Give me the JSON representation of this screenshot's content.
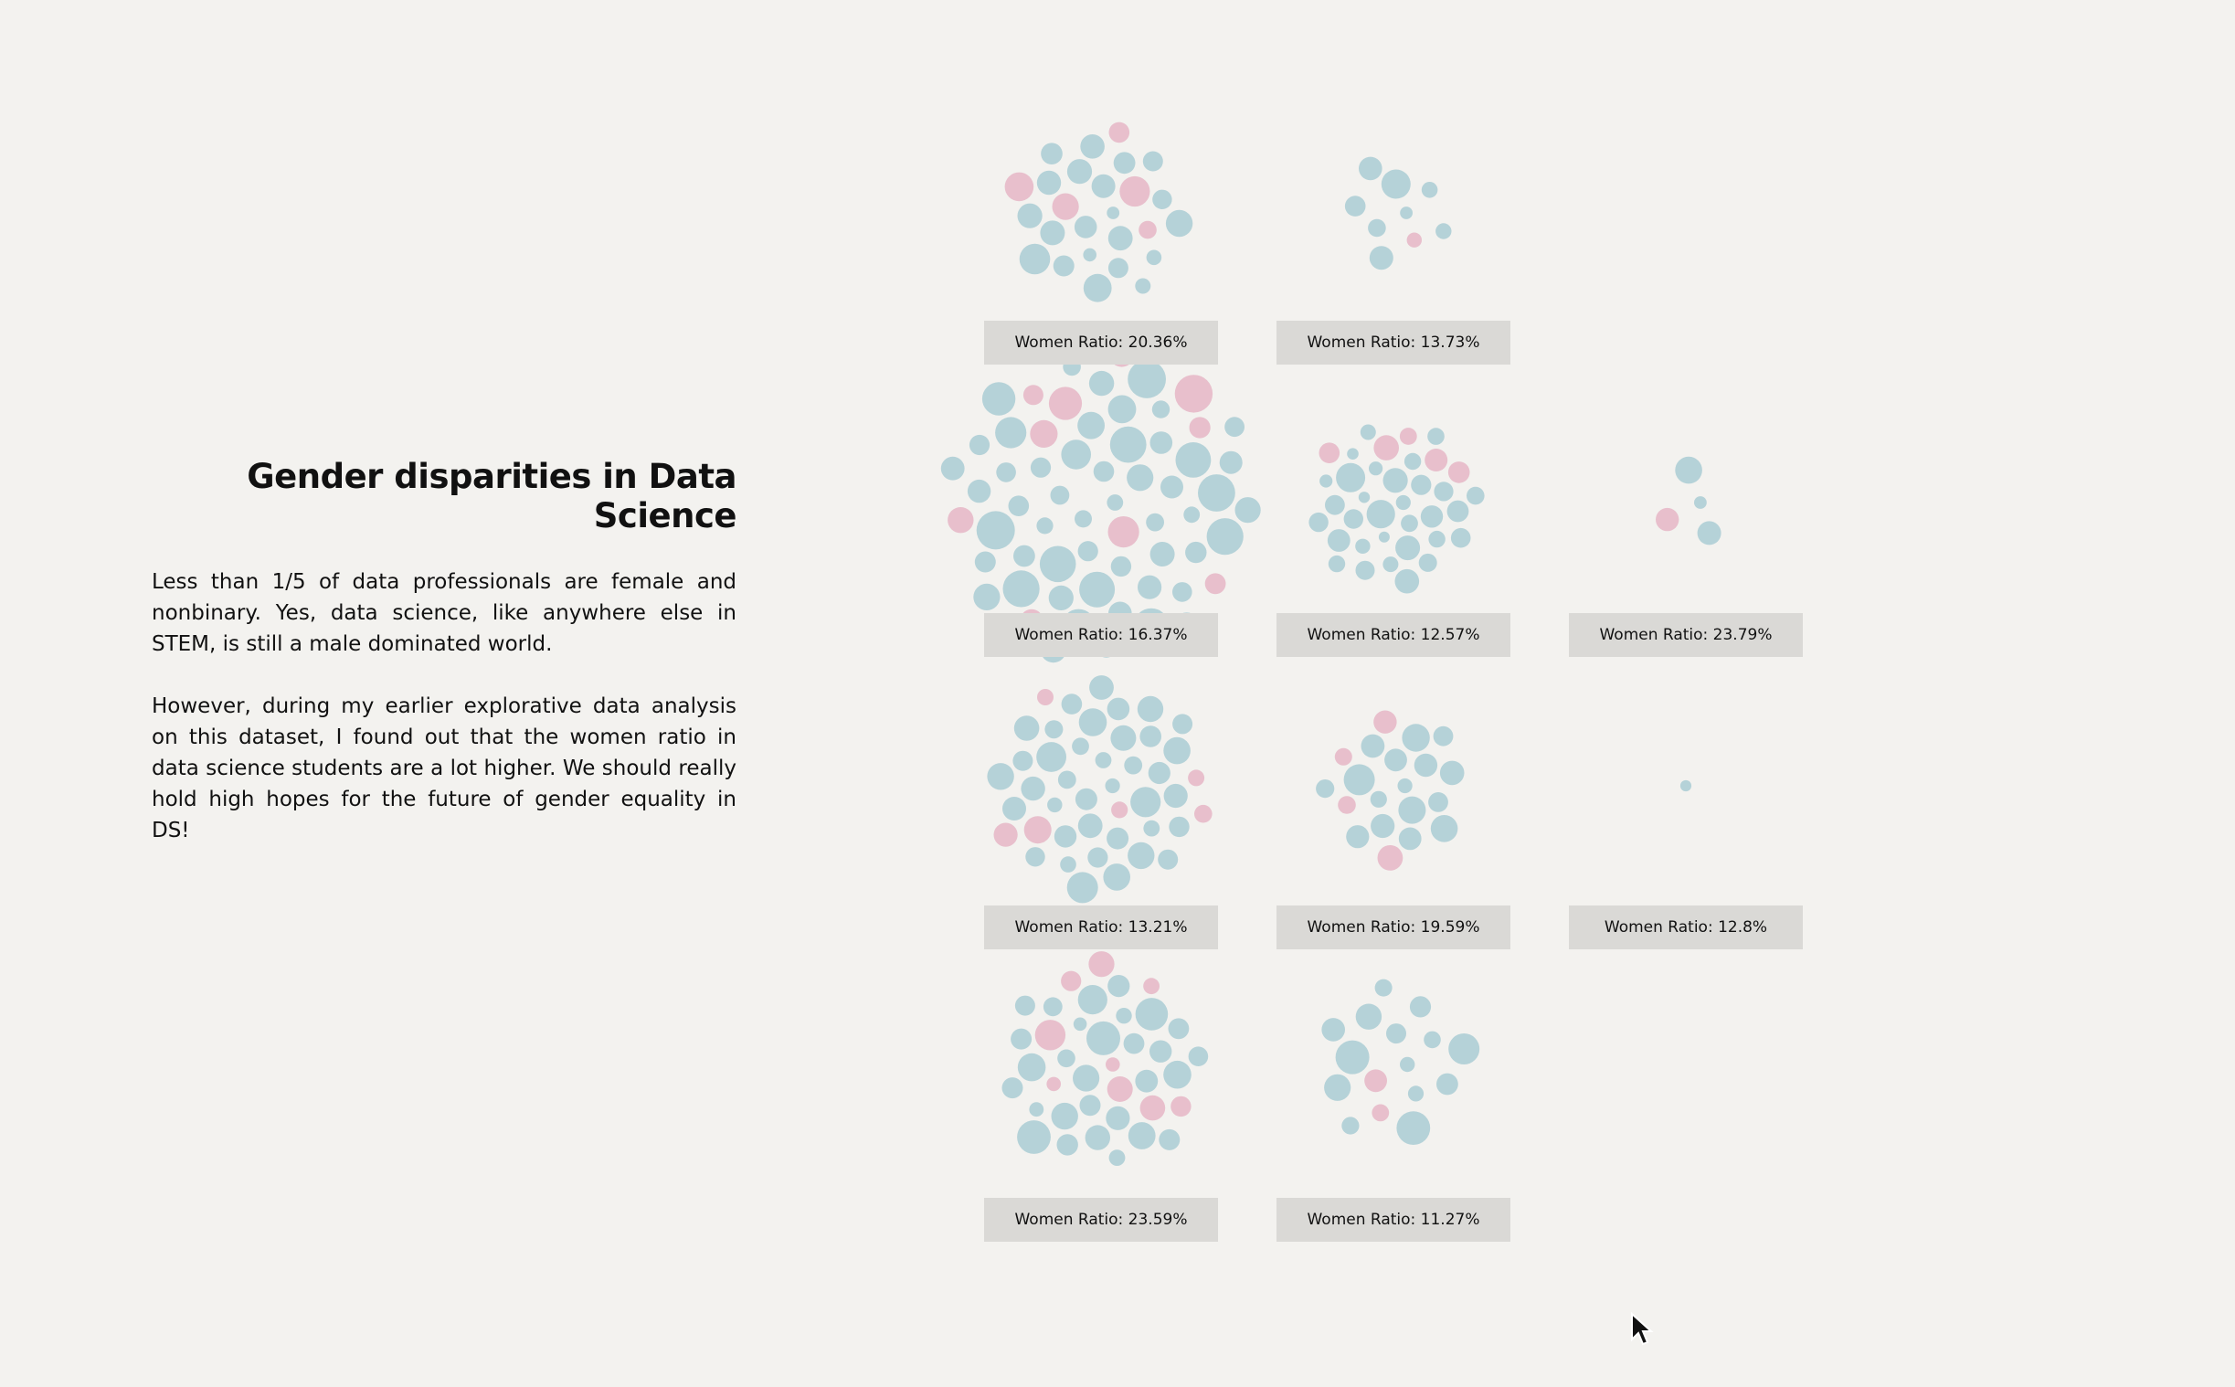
{
  "title": "Gender disparities in Data Science",
  "paragraphs": [
    "Less than 1/5 of data professionals are female and nonbinary. Yes, data science, like anywhere else in STEM, is still a male dominated world.",
    "However, during my earlier explorative data analysis on this dataset, I found out that the women ratio in data science students are a lot higher. We should really hold high hopes for the future of gender equality in DS!"
  ],
  "colors": {
    "men": "#a9cdd3",
    "women": "#e5b6c5",
    "background": "#f3f2ef",
    "label_bg": "#dad9d6"
  },
  "chart_data": {
    "type": "packed-bubble-small-multiples",
    "label_prefix": "Women Ratio: ",
    "panels": [
      {
        "women_ratio": "20.36%",
        "row": 1,
        "col": 1
      },
      {
        "women_ratio": "13.73%",
        "row": 1,
        "col": 2
      },
      {
        "women_ratio": "16.37%",
        "row": 2,
        "col": 1
      },
      {
        "women_ratio": "12.57%",
        "row": 2,
        "col": 2
      },
      {
        "women_ratio": "23.79%",
        "row": 2,
        "col": 3
      },
      {
        "women_ratio": "13.21%",
        "row": 3,
        "col": 1
      },
      {
        "women_ratio": "19.59%",
        "row": 3,
        "col": 2
      },
      {
        "women_ratio": "12.8%",
        "row": 3,
        "col": 3
      },
      {
        "women_ratio": "23.59%",
        "row": 4,
        "col": 1
      },
      {
        "women_ratio": "11.27%",
        "row": 4,
        "col": 2
      }
    ]
  }
}
